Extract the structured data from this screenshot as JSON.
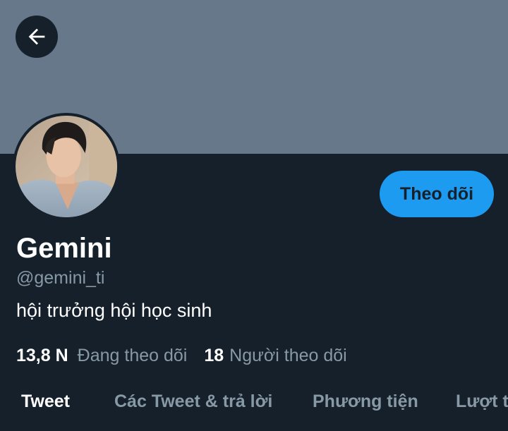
{
  "header": {
    "back_icon": "arrow-left-icon"
  },
  "profile": {
    "display_name": "Gemini",
    "handle": "@gemini_ti",
    "bio": "hội trưởng hội học sinh",
    "follow_label": "Theo dõi",
    "following_count": "13,8 N",
    "following_label": "Đang theo dõi",
    "followers_count": "18",
    "followers_label": "Người theo dõi"
  },
  "tabs": [
    {
      "label": "Tweet",
      "active": true
    },
    {
      "label": "Các Tweet & trả lời",
      "active": false
    },
    {
      "label": "Phương tiện",
      "active": false
    },
    {
      "label": "Lượt thích",
      "active": false
    }
  ],
  "colors": {
    "background": "#15202b",
    "banner": "#66788a",
    "accent": "#1d9bf0",
    "secondary_text": "#8899a6"
  }
}
